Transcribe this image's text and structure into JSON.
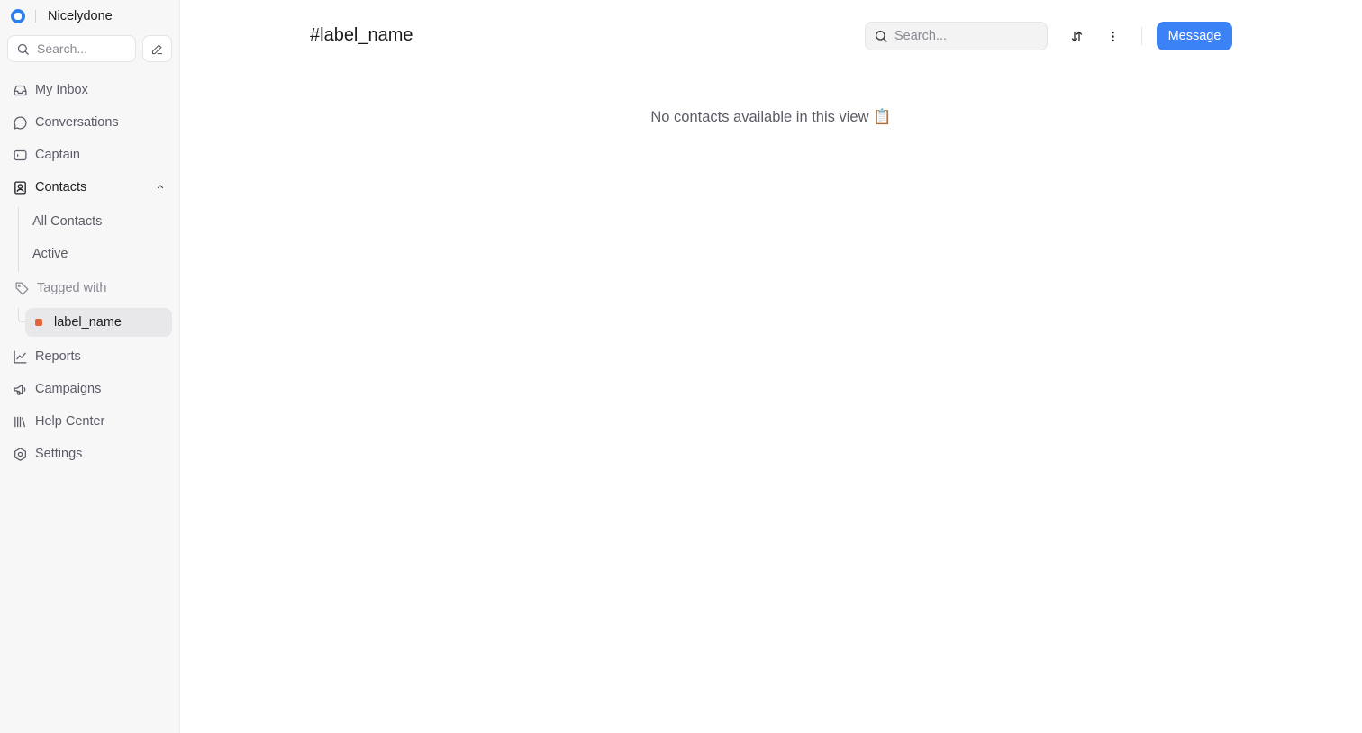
{
  "brand": {
    "name": "Nicelydone"
  },
  "sidebar": {
    "search_placeholder": "Search...",
    "items": [
      {
        "label": "My Inbox",
        "icon": "inbox-icon"
      },
      {
        "label": "Conversations",
        "icon": "chat-bubble-icon"
      },
      {
        "label": "Captain",
        "icon": "captain-icon"
      },
      {
        "label": "Contacts",
        "icon": "contacts-icon",
        "expanded": true
      },
      {
        "label": "Reports",
        "icon": "chart-line-icon"
      },
      {
        "label": "Campaigns",
        "icon": "megaphone-icon"
      },
      {
        "label": "Help Center",
        "icon": "library-icon"
      },
      {
        "label": "Settings",
        "icon": "settings-icon"
      }
    ],
    "contacts_sub": [
      "All Contacts",
      "Active"
    ],
    "tagged_with": "Tagged with",
    "labels": [
      {
        "name": "label_name",
        "color": "#e0653a",
        "active": true
      }
    ]
  },
  "header": {
    "title": "#label_name",
    "search_placeholder": "Search...",
    "message_button": "Message"
  },
  "main": {
    "empty_message": "No contacts available in this view 📋"
  },
  "colors": {
    "accent": "#3b82f6",
    "label": "#e0653a"
  }
}
